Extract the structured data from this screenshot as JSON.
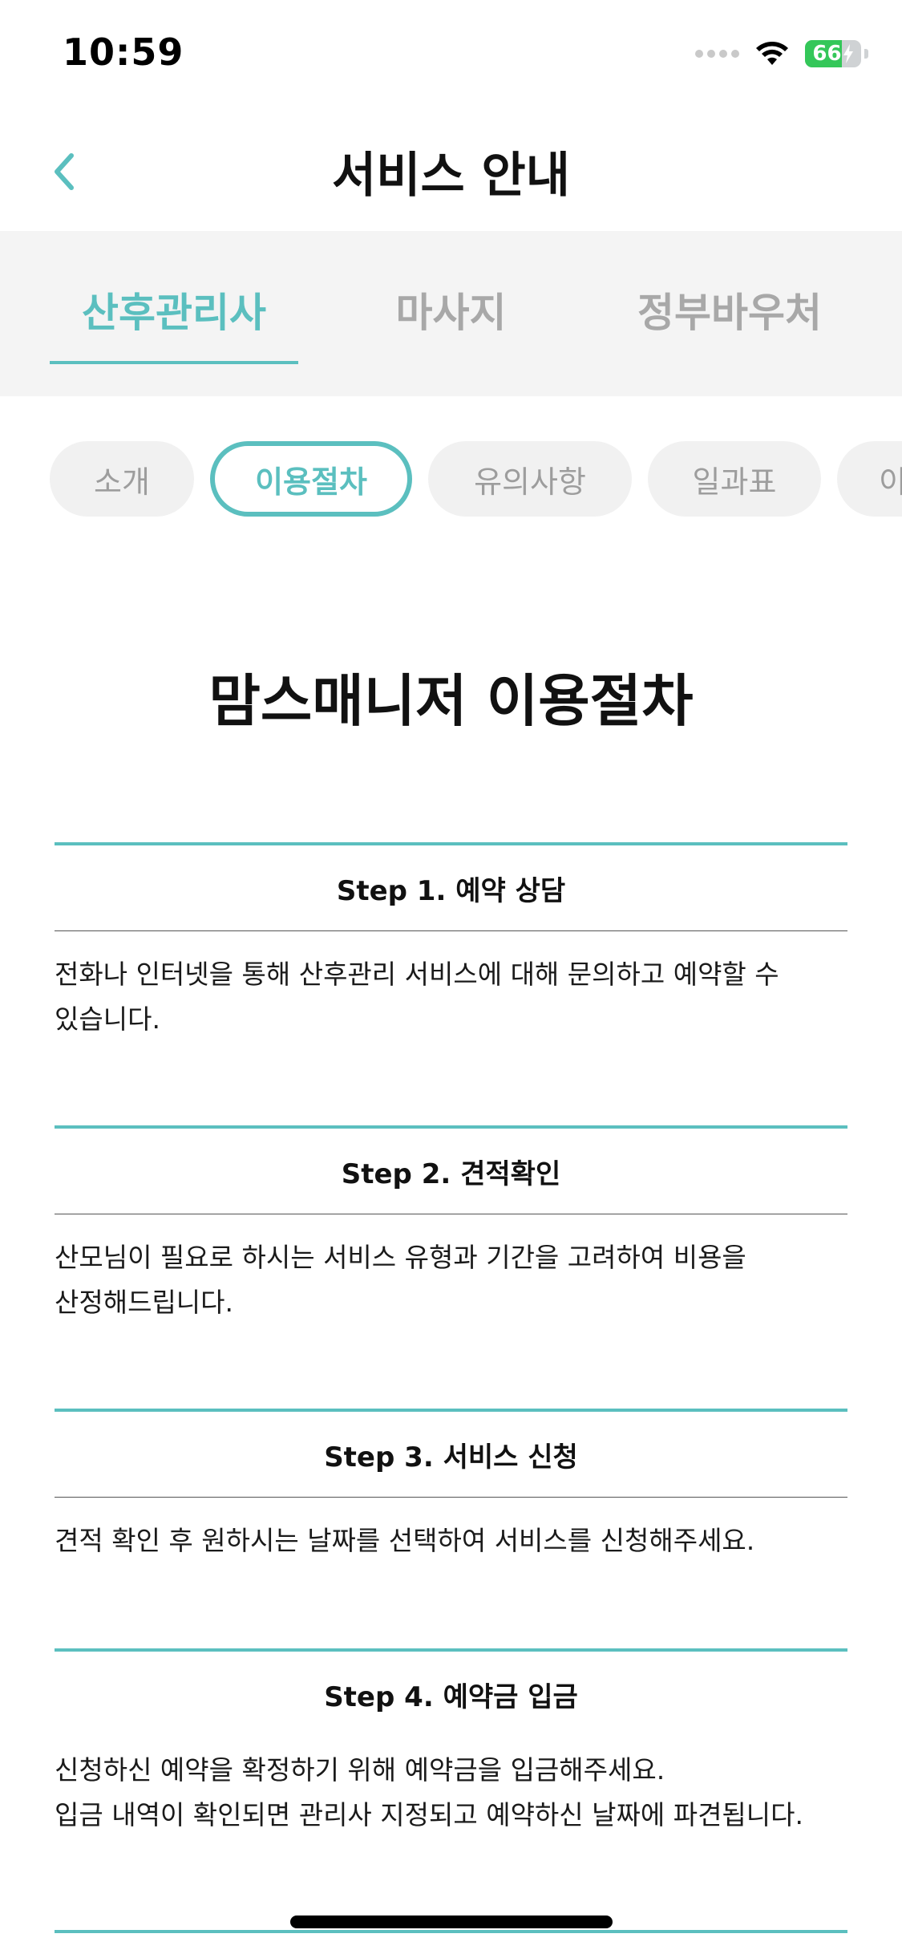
{
  "status_bar": {
    "time": "10:59",
    "battery_level": "66",
    "battery_fraction": 0.66,
    "icons": [
      "cellular-signal-icon",
      "wifi-icon",
      "battery-icon",
      "charging-bolt-icon"
    ]
  },
  "header": {
    "title": "서비스 안내",
    "back_icon": "chevron-left-icon"
  },
  "main_tabs": [
    {
      "label": "산후관리사",
      "active": true
    },
    {
      "label": "마사지",
      "active": false
    },
    {
      "label": "정부바우처",
      "active": false
    }
  ],
  "sub_tabs": [
    {
      "label": "소개",
      "active": false
    },
    {
      "label": "이용절차",
      "active": true
    },
    {
      "label": "유의사항",
      "active": false
    },
    {
      "label": "일과표",
      "active": false
    },
    {
      "label": "이",
      "active": false
    }
  ],
  "content": {
    "title": "맘스매니저 이용절차",
    "steps": [
      {
        "title": "Step 1. 예약 상담",
        "description": "전화나 인터넷을 통해 산후관리 서비스에 대해 문의하고 예약할 수\n있습니다."
      },
      {
        "title": "Step 2. 견적확인",
        "description": "산모님이 필요로 하시는 서비스 유형과 기간을 고려하여 비용을\n산정해드립니다."
      },
      {
        "title": "Step 3. 서비스 신청",
        "description": "견적 확인 후 원하시는 날짜를 선택하여 서비스를 신청해주세요."
      },
      {
        "title": "Step 4. 예약금 입금",
        "description": "신청하신 예약을 확정하기 위해 예약금을 입금해주세요.\n입금 내역이 확인되면 관리사 지정되고 예약하신 날짜에 파견됩니다."
      }
    ]
  },
  "colors": {
    "accent": "#5bbfbf",
    "tab_background": "#f4f4f4",
    "chip_background": "#f1f1f1",
    "inactive_text": "#a8a8a8",
    "battery_green": "#34c759"
  }
}
